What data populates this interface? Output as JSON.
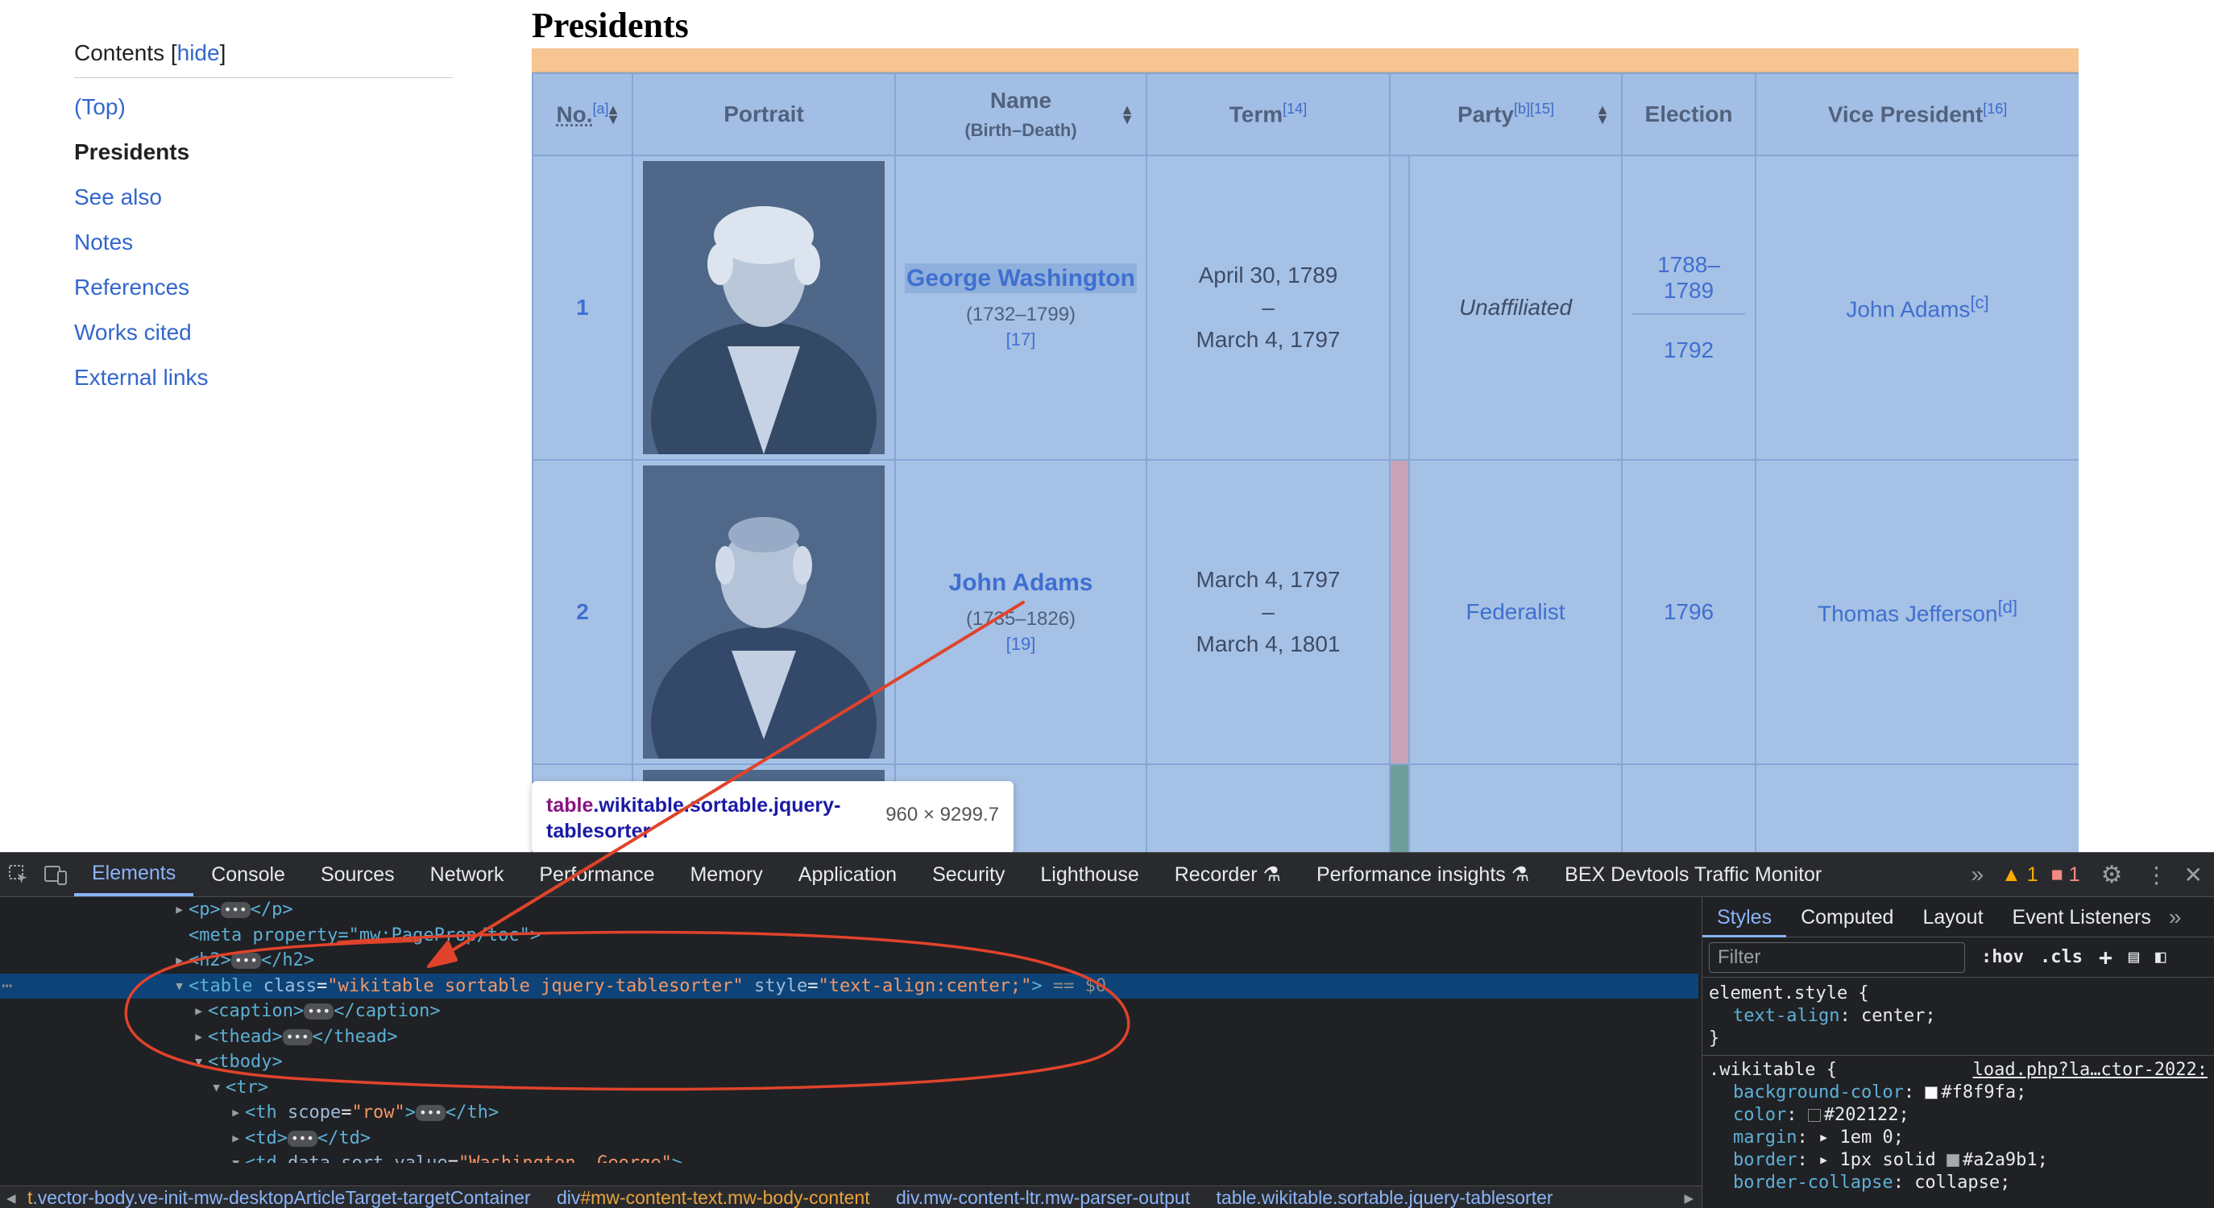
{
  "toc": {
    "title": "Contents",
    "hide_label": "hide",
    "items": [
      "(Top)",
      "Presidents",
      "See also",
      "Notes",
      "References",
      "Works cited",
      "External links"
    ]
  },
  "article": {
    "heading": "Presidents",
    "table": {
      "headers": {
        "no": "No.",
        "no_ref": "[a]",
        "portrait": "Portrait",
        "name": "Name",
        "name_sub": "(Birth–Death)",
        "term": "Term",
        "term_ref": "[14]",
        "party": "Party",
        "party_ref": "[b][15]",
        "election": "Election",
        "vp": "Vice President",
        "vp_ref": "[16]"
      },
      "rows": [
        {
          "no": "1",
          "name": "George Washington",
          "life": "(1732–1799)",
          "ref": "[17]",
          "term_start": "April 30, 1789",
          "term_dash": "–",
          "term_end": "March 4, 1797",
          "party": "Unaffiliated",
          "party_color": "#a2bee5",
          "election_1": "1788–1789",
          "election_2": "1792",
          "vp": "John Adams",
          "vp_ref": "[c]"
        },
        {
          "no": "2",
          "name": "John Adams",
          "life": "(1735–1826)",
          "ref": "[19]",
          "term_start": "March 4, 1797",
          "term_dash": "–",
          "term_end": "March 4, 1801",
          "party": "Federalist",
          "party_color": "#c9a3b8",
          "election_1": "1796",
          "vp": "Thomas Jefferson",
          "vp_ref": "[d]"
        },
        {
          "party_color": "#6f9d9a"
        }
      ]
    }
  },
  "tooltip": {
    "tag": "table",
    "classes": ".wikitable.sortable.jquery-tablesorter",
    "dimensions": "960 × 9299.7"
  },
  "devtools": {
    "tabs": [
      "Elements",
      "Console",
      "Sources",
      "Network",
      "Performance",
      "Memory",
      "Application",
      "Security",
      "Lighthouse",
      "Recorder",
      "Performance insights",
      "BEX Devtools Traffic Monitor"
    ],
    "warnings": "1",
    "errors": "1",
    "dom_lines": {
      "l0_tag": "<p>",
      "l0_close": "</p>",
      "l1": "<meta property=\"mw:PageProp/toc\">",
      "l2_tag": "<h2>",
      "l2_close": "</h2>",
      "l3_open": "<table",
      "l3_attr1": "class",
      "l3_val1": "\"wikitable sortable jquery-tablesorter\"",
      "l3_attr2": "style",
      "l3_val2": "\"text-align:center;\"",
      "l3_end": ">",
      "l3_marker": "== $0",
      "l4_tag": "<caption>",
      "l4_close": "</caption>",
      "l5_tag": "<thead>",
      "l5_close": "</thead>",
      "l6": "<tbody>",
      "l7": "<tr>",
      "l8_open": "<th",
      "l8_attr": "scope",
      "l8_val": "\"row\"",
      "l8_end": ">",
      "l8_close": "</th>",
      "l9_tag": "<td>",
      "l9_close": "</td>",
      "l10_open": "<td",
      "l10_attr": "data-sort-value",
      "l10_val": "\"Washington, George\"",
      "l10_end": ">"
    },
    "breadcrumbs": [
      {
        "tag": "t",
        "cls": ".vector-body.ve-init-mw-desktopArticleTarget-targetContainer"
      },
      {
        "tag": "div",
        "cls": "#mw-content-text.mw-body-content"
      },
      {
        "tag": "div",
        "cls": ".mw-content-ltr.mw-parser-output"
      },
      {
        "tag": "table",
        "cls": ".wikitable.sortable.jquery-tablesorter"
      }
    ],
    "styles": {
      "tabs": [
        "Styles",
        "Computed",
        "Layout",
        "Event Listeners"
      ],
      "filter_placeholder": "Filter",
      "hov": ":hov",
      "cls": ".cls",
      "rule1_selector": "element.style {",
      "rule1_prop": "text-align",
      "rule1_val": "center;",
      "close": "}",
      "rule2_selector": ".wikitable {",
      "rule2_source": "load.php?la…ctor-2022:",
      "props": [
        {
          "name": "background-color",
          "value": "#f8f9fa;",
          "swatch": "#f8f9fa"
        },
        {
          "name": "color",
          "value": "#202122;",
          "swatch": "#202122"
        },
        {
          "name": "margin",
          "value": "1em 0;",
          "arrow": true
        },
        {
          "name": "border",
          "value": "1px solid",
          "value2": "#a2a9b1;",
          "swatch": "#a2a9b1",
          "arrow": true
        },
        {
          "name": "border-collapse",
          "value": "collapse;"
        }
      ]
    }
  }
}
